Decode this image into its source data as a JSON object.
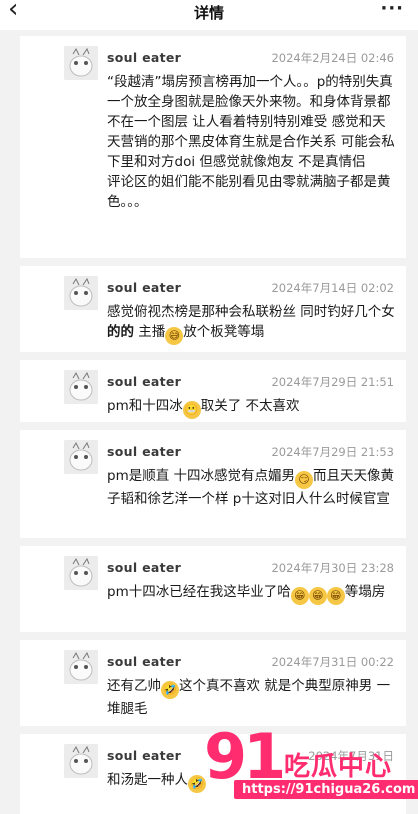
{
  "header": {
    "back_icon": "chevron-left-icon",
    "title": "详情",
    "more_icon": "ellipsis-icon"
  },
  "comments": [
    {
      "name": "soul eater",
      "time": "2024年2月24日 02:46",
      "text": "“段越清”塌房预言榜再加一个人。。p的特别失真 一个放全身图就是脸像天外来物。和身体背景都不在一个图层 让人看着特别特别难受 感觉和天天营销的那个黑皮体育生就是合作关系 可能会私下里和对方doi 但感觉就像炮友 不是真情侣\n评论区的姐们能不能别看见由零就满脑子都是黄色。。。"
    },
    {
      "name": "soul eater",
      "time": "2024年7月14日 02:02",
      "text_before": "感觉俯视杰榜是那种会私联粉丝 同时钓好几个女 ",
      "text_bold": "的的",
      "text_mid": " 主播",
      "text_after": "放个板凳等塌"
    },
    {
      "name": "soul eater",
      "time": "2024年7月29日 21:51",
      "text_before": "pm和十四冰",
      "text_after": "取关了 不太喜欢"
    },
    {
      "name": "soul eater",
      "time": "2024年7月29日 21:53",
      "text_before": "pm是顺直 十四冰感觉有点媚男",
      "text_after": "而且天天像黄子韬和徐艺洋一个样 p十这对旧人什么时候官宣"
    },
    {
      "name": "soul eater",
      "time": "2024年7月30日 23:28",
      "text_before": "pm十四冰已经在我这毕业了哈",
      "text_after": "等塌房"
    },
    {
      "name": "soul eater",
      "time": "2024年7月31日 00:22",
      "text_before": "还有乙帅",
      "text_after": "这个真不喜欢 就是个典型原神男 一堆腿毛"
    },
    {
      "name": "soul eater",
      "time": "2024年7月31日",
      "text_before": "和汤匙一种人"
    }
  ],
  "watermark": {
    "logo": "91",
    "name": "吃瓜中心",
    "url": "https://91chigua26.com"
  }
}
